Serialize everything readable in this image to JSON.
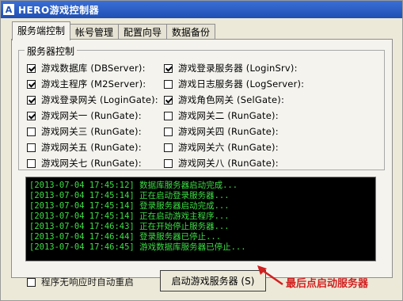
{
  "window": {
    "title": "HERO游戏控制器",
    "icon": "A"
  },
  "tabs": [
    "服务端控制",
    "帐号管理",
    "配置向导",
    "数据备份"
  ],
  "group_label": "服务器控制",
  "checkboxes_left": [
    {
      "label": "游戏数据库 (DBServer):",
      "checked": true
    },
    {
      "label": "游戏主程序 (M2Server):",
      "checked": true
    },
    {
      "label": "游戏登录网关 (LoginGate):",
      "checked": true
    },
    {
      "label": "游戏网关一 (RunGate):",
      "checked": true
    },
    {
      "label": "游戏网关三 (RunGate):",
      "checked": false
    },
    {
      "label": "游戏网关五 (RunGate):",
      "checked": false
    },
    {
      "label": "游戏网关七 (RunGate):",
      "checked": false
    }
  ],
  "checkboxes_right": [
    {
      "label": "游戏登录服务器 (LoginSrv):",
      "checked": true
    },
    {
      "label": "游戏日志服务器 (LogServer):",
      "checked": false
    },
    {
      "label": "游戏角色网关 (SelGate):",
      "checked": true
    },
    {
      "label": "游戏网关二 (RunGate):",
      "checked": false
    },
    {
      "label": "游戏网关四 (RunGate):",
      "checked": false
    },
    {
      "label": "游戏网关六 (RunGate):",
      "checked": false
    },
    {
      "label": "游戏网关八 (RunGate):",
      "checked": false
    }
  ],
  "log_lines": [
    "[2013-07-04 17:45:12] 数据库服务器启动完成...",
    "[2013-07-04 17:45:14] 正在启动登录服务器...",
    "[2013-07-04 17:45:14] 登录服务器启动完成...",
    "[2013-07-04 17:45:14] 正在启动游戏主程序...",
    "[2013-07-04 17:46:43] 正在开始停止服务器...",
    "[2013-07-04 17:46:44] 登录服务器已停止...",
    "[2013-07-04 17:46:45] 游戏数据库服务器已停止..."
  ],
  "footer": {
    "auto_restart_label": "程序无响应时自动重启",
    "auto_restart_checked": false,
    "start_button": "启动游戏服务器 (S)",
    "annotation": "最后点启动服务器"
  },
  "colors": {
    "log_text": "#3ddf46",
    "annotation": "#d21f1f",
    "title_bar": "#2a5ac4"
  }
}
